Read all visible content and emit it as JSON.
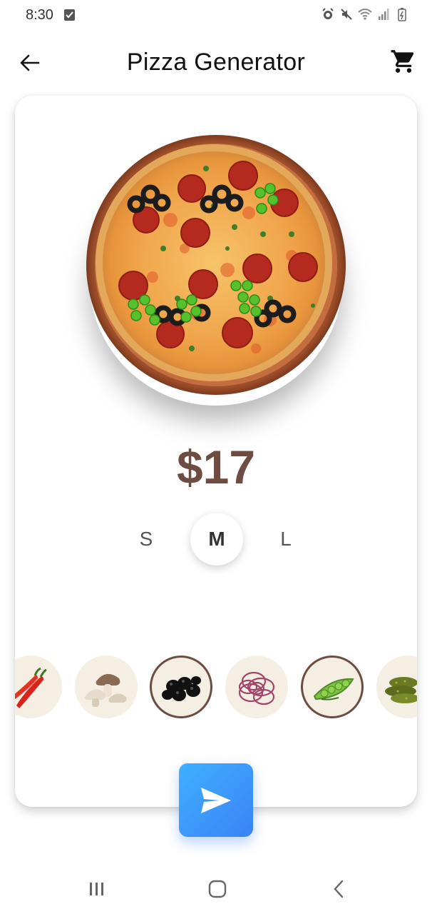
{
  "status_bar": {
    "time": "8:30",
    "icons": [
      "check-notification-icon",
      "alarm-icon",
      "mute-icon",
      "wifi-icon",
      "signal-icon",
      "battery-icon"
    ]
  },
  "app_bar": {
    "title": "Pizza Generator",
    "back_icon": "arrow-left-icon",
    "cart_icon": "cart-icon"
  },
  "pizza": {
    "toppings_on_pizza": [
      "pepperoni",
      "olives",
      "peas",
      "herbs"
    ]
  },
  "price": "$17",
  "sizes": {
    "options": [
      "S",
      "M",
      "L"
    ],
    "selected": "M"
  },
  "ingredients": [
    {
      "name": "chili-pepper",
      "selected": false
    },
    {
      "name": "mushroom",
      "selected": false
    },
    {
      "name": "olives",
      "selected": true
    },
    {
      "name": "onion",
      "selected": false
    },
    {
      "name": "peas",
      "selected": true
    },
    {
      "name": "pickles",
      "selected": false
    }
  ],
  "send_icon": "send-icon",
  "colors": {
    "price": "#6d4c41",
    "selected_border": "#6d4c41",
    "ingredient_bg": "#f5efe3",
    "send_button": "#3b82f6"
  }
}
